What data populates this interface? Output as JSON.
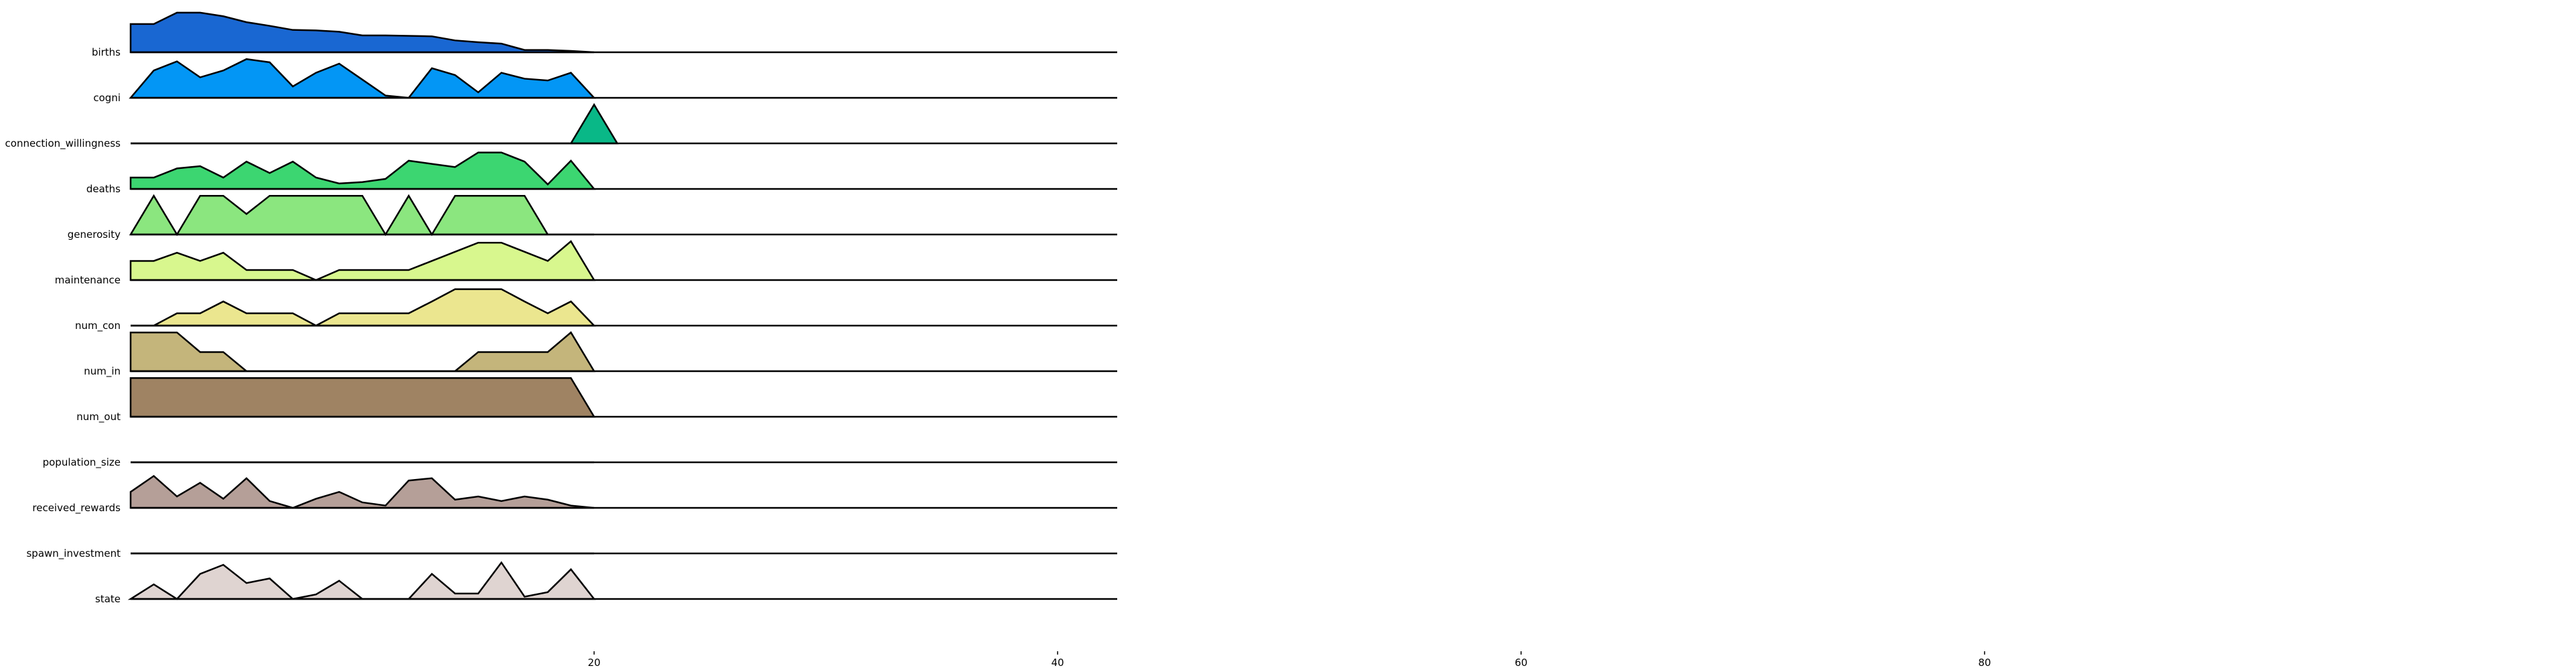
{
  "chart_data": {
    "type": "area",
    "xlim": [
      0,
      100
    ],
    "x_ticks": [
      20,
      40,
      60,
      80
    ],
    "series": [
      {
        "name": "births",
        "color": "#1967d2",
        "x": [
          0,
          1,
          2,
          3,
          4,
          5,
          6,
          7,
          8,
          9,
          10,
          11,
          12,
          13,
          14,
          15,
          16,
          17,
          18,
          19,
          20
        ],
        "values": [
          0.62,
          0.62,
          0.87,
          0.87,
          0.79,
          0.66,
          0.58,
          0.49,
          0.48,
          0.45,
          0.37,
          0.37,
          0.36,
          0.35,
          0.26,
          0.22,
          0.19,
          0.05,
          0.05,
          0.03,
          0
        ]
      },
      {
        "name": "cogni",
        "color": "#0396f5",
        "x": [
          0,
          1,
          2,
          3,
          4,
          5,
          6,
          7,
          8,
          9,
          10,
          11,
          12,
          13,
          14,
          15,
          16,
          17,
          18,
          19,
          20
        ],
        "values": [
          0,
          0.6,
          0.8,
          0.45,
          0.6,
          0.85,
          0.78,
          0.25,
          0.55,
          0.75,
          0.4,
          0.05,
          0,
          0.65,
          0.5,
          0.12,
          0.55,
          0.42,
          0.38,
          0.55,
          0
        ]
      },
      {
        "name": "connection_willingness",
        "color": "#09b887",
        "x": [
          0,
          1,
          19,
          20,
          21
        ],
        "values": [
          0,
          0,
          0,
          0.85,
          0
        ]
      },
      {
        "name": "deaths",
        "color": "#3cd671",
        "x": [
          0,
          1,
          2,
          3,
          4,
          5,
          6,
          7,
          8,
          9,
          10,
          11,
          12,
          13,
          14,
          15,
          16,
          17,
          18,
          19,
          20
        ],
        "values": [
          0.25,
          0.25,
          0.45,
          0.5,
          0.25,
          0.6,
          0.35,
          0.6,
          0.25,
          0.12,
          0.15,
          0.22,
          0.62,
          0.55,
          0.48,
          0.8,
          0.8,
          0.6,
          0.1,
          0.62,
          0
        ]
      },
      {
        "name": "generosity",
        "color": "#8be67f",
        "x": [
          0,
          1,
          2,
          3,
          4,
          5,
          6,
          7,
          8,
          9,
          10,
          11,
          12,
          13,
          14,
          15,
          16,
          17,
          18,
          19,
          20
        ],
        "values": [
          0,
          0.85,
          0,
          0.85,
          0.85,
          0.45,
          0.85,
          0.85,
          0.85,
          0.85,
          0.85,
          0,
          0.85,
          0,
          0.85,
          0.85,
          0.85,
          0.85,
          0,
          0,
          0
        ]
      },
      {
        "name": "maintenance",
        "color": "#d8f78e",
        "x": [
          0,
          1,
          2,
          3,
          4,
          5,
          6,
          7,
          8,
          9,
          10,
          11,
          12,
          13,
          14,
          15,
          16,
          17,
          18,
          19,
          20
        ],
        "values": [
          0.42,
          0.42,
          0.6,
          0.42,
          0.6,
          0.22,
          0.22,
          0.22,
          0,
          0.22,
          0.22,
          0.22,
          0.22,
          0.42,
          0.62,
          0.82,
          0.82,
          0.62,
          0.42,
          0.85,
          0
        ]
      },
      {
        "name": "num_con",
        "color": "#ebe68f",
        "x": [
          0,
          1,
          2,
          3,
          4,
          5,
          6,
          7,
          8,
          9,
          10,
          11,
          12,
          13,
          14,
          15,
          16,
          17,
          18,
          19,
          20
        ],
        "values": [
          0,
          0,
          0.27,
          0.27,
          0.53,
          0.27,
          0.27,
          0.27,
          0,
          0.27,
          0.27,
          0.27,
          0.27,
          0.53,
          0.8,
          0.8,
          0.8,
          0.53,
          0.27,
          0.53,
          0
        ]
      },
      {
        "name": "num_in",
        "color": "#c4b57b",
        "x": [
          0,
          1,
          2,
          3,
          4,
          5,
          6,
          7,
          8,
          9,
          10,
          11,
          12,
          13,
          14,
          15,
          16,
          17,
          18,
          19,
          20
        ],
        "values": [
          0.85,
          0.85,
          0.85,
          0.42,
          0.42,
          0,
          0,
          0,
          0,
          0,
          0,
          0,
          0,
          0,
          0,
          0.42,
          0.42,
          0.42,
          0.42,
          0.85,
          0
        ]
      },
      {
        "name": "num_out",
        "color": "#9f8363",
        "x": [
          0,
          19,
          20
        ],
        "values": [
          0.85,
          0.85,
          0
        ]
      },
      {
        "name": "population_size",
        "color": "#9f8363",
        "x": [
          0,
          20
        ],
        "values": [
          0,
          0
        ]
      },
      {
        "name": "received_rewards",
        "color": "#b59f98",
        "x": [
          0,
          1,
          2,
          3,
          4,
          5,
          6,
          7,
          8,
          9,
          10,
          11,
          12,
          13,
          14,
          15,
          16,
          17,
          18,
          19,
          20
        ],
        "values": [
          0.35,
          0.7,
          0.25,
          0.55,
          0.2,
          0.65,
          0.15,
          0,
          0.2,
          0.35,
          0.12,
          0.05,
          0.6,
          0.65,
          0.18,
          0.25,
          0.15,
          0.25,
          0.18,
          0.05,
          0
        ]
      },
      {
        "name": "spawn_investment",
        "color": "#b59f98",
        "x": [
          0,
          20
        ],
        "values": [
          0,
          0
        ]
      },
      {
        "name": "state",
        "color": "#dfd4d1",
        "x": [
          0,
          1,
          2,
          3,
          4,
          5,
          6,
          7,
          8,
          9,
          10,
          11,
          12,
          13,
          14,
          15,
          16,
          17,
          18,
          19,
          20
        ],
        "values": [
          0,
          0.32,
          0,
          0.55,
          0.75,
          0.35,
          0.45,
          0,
          0.1,
          0.4,
          0,
          0,
          0,
          0.55,
          0.12,
          0.12,
          0.8,
          0.05,
          0.15,
          0.65,
          0
        ]
      }
    ]
  }
}
